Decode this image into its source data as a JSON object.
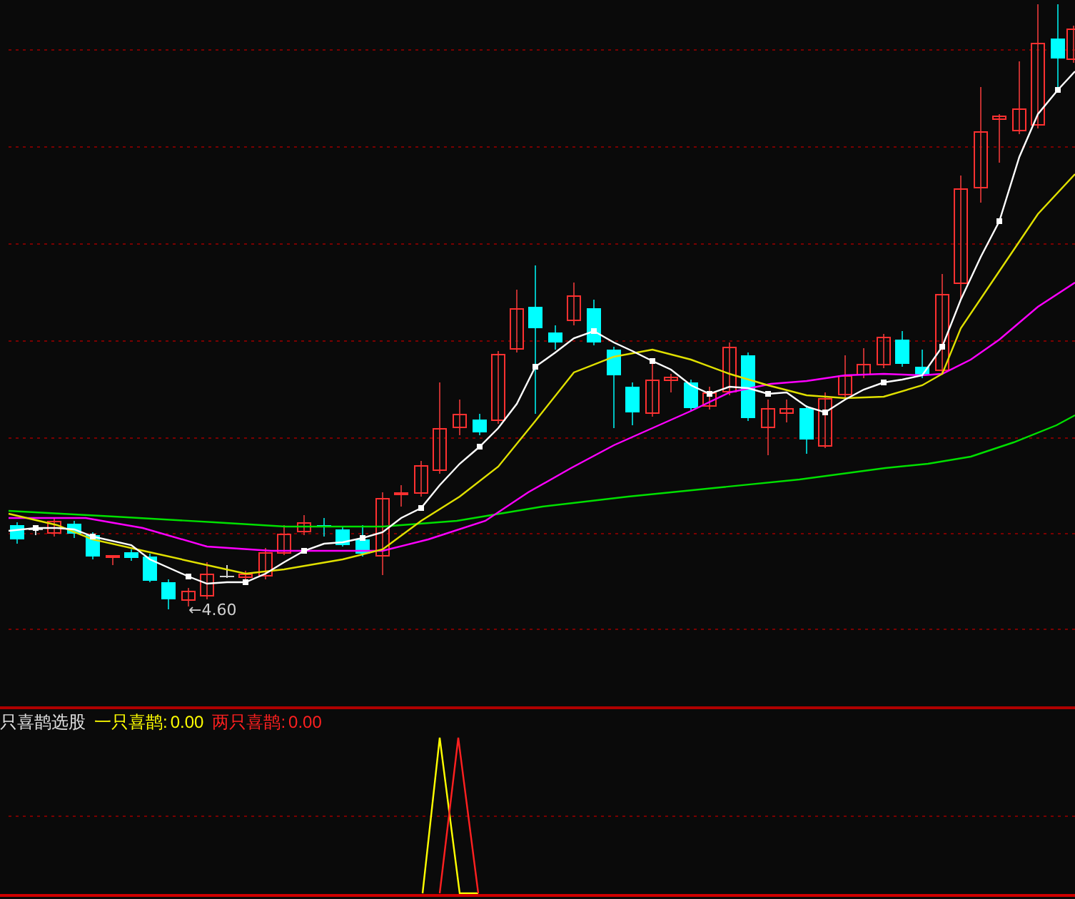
{
  "main_chart": {
    "price_label": "←4.60"
  },
  "indicator_panel": {
    "title": "只喜鹊选股",
    "series": [
      {
        "label": "一只喜鹊:",
        "value": "0.00",
        "color": "#ffff00"
      },
      {
        "label": "两只喜鹊:",
        "value": "0.00",
        "color": "#ff2020"
      }
    ]
  }
}
